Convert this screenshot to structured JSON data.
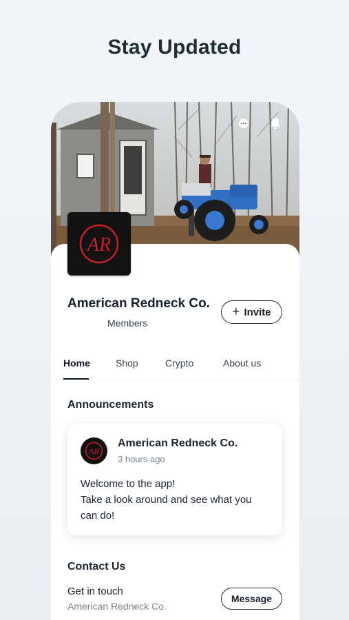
{
  "headline": "Stay Updated",
  "colors": {
    "background": "#eef2f6",
    "text": "#16202b",
    "logo_red": "#c8202a",
    "logo_bg": "#121212"
  },
  "header_icons": [
    "chat-icon",
    "bell-icon"
  ],
  "profile": {
    "logo_text": "AR",
    "name": "American Redneck Co.",
    "members_label": "Members",
    "invite_label": "Invite"
  },
  "tabs": [
    {
      "label": "Home",
      "active": true
    },
    {
      "label": "Shop",
      "active": false
    },
    {
      "label": "Crypto",
      "active": false
    },
    {
      "label": "About us",
      "active": false
    }
  ],
  "announcements": {
    "title": "Announcements",
    "post": {
      "author": "American Redneck Co.",
      "time": "3 hours ago",
      "lines": [
        "Welcome to the app!",
        "Take a look around and see what you",
        "can do!"
      ]
    }
  },
  "contact": {
    "title": "Contact Us",
    "label": "Get in touch",
    "sub": "American Redneck Co.",
    "button": "Message"
  }
}
